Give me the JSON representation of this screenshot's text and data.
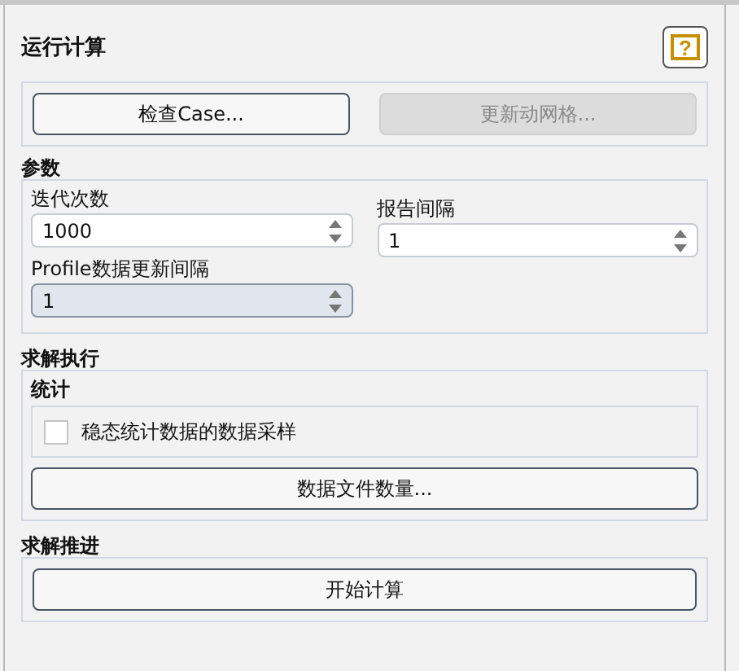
{
  "title": "运行计算",
  "help_button": "?",
  "top_buttons": [
    {
      "label": "检查Case...",
      "disabled": false
    },
    {
      "label": "更新动网格...",
      "disabled": true
    }
  ],
  "parameters": {
    "heading": "参数",
    "fields": [
      {
        "label": "迭代次数",
        "value": "1000",
        "highlighted": false
      },
      {
        "label": "报告间隔",
        "value": "1",
        "highlighted": false
      },
      {
        "label": "Profile数据更新间隔",
        "value": "1",
        "highlighted": true
      }
    ]
  },
  "execution": {
    "heading": "求解执行",
    "statistics": {
      "heading": "统计",
      "checkbox": {
        "label": "稳态统计数据的数据采样",
        "checked": false
      }
    },
    "button": "数据文件数量..."
  },
  "advance": {
    "heading": "求解推进",
    "button": "开始计算"
  }
}
